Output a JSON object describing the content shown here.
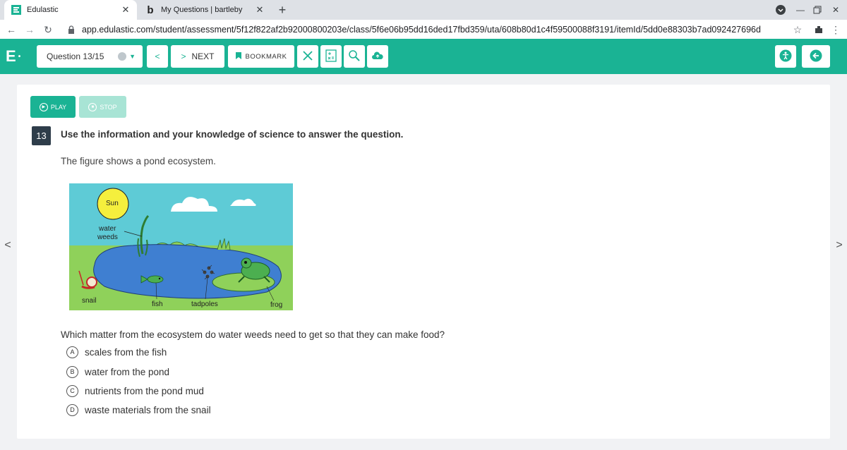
{
  "browser": {
    "tabs": [
      {
        "title": "Edulastic",
        "icon": "edulastic-favicon",
        "active": true
      },
      {
        "title": "My Questions | bartleby",
        "icon": "bartleby-favicon",
        "active": false
      }
    ],
    "url": "app.edulastic.com/student/assessment/5f12f822af2b92000800203e/class/5f6e06b95dd16ded17fbd359/uta/608b80d1c4f59500088f3191/itemId/5dd0e88303b7ad092427696d"
  },
  "header": {
    "logo": "E",
    "question_selector": "Question 13/15",
    "next_label": "NEXT",
    "bookmark_label": "BOOKMARK"
  },
  "audio": {
    "play_label": "PLAY",
    "stop_label": "STOP"
  },
  "question": {
    "number": "13",
    "stem": "Use the information and your knowledge of science to answer the question.",
    "figure_intro": "The figure shows a pond ecosystem.",
    "figure_labels": {
      "sun": "Sun",
      "water": "water",
      "weeds": "weeds",
      "snail": "snail",
      "fish": "fish",
      "tadpoles": "tadpoles",
      "frog": "frog"
    },
    "prompt": "Which matter from the ecosystem do water weeds need to get so that they can make food?",
    "choices": [
      {
        "letter": "A",
        "text": "scales from the fish"
      },
      {
        "letter": "B",
        "text": "water from the pond"
      },
      {
        "letter": "C",
        "text": "nutrients from the pond mud"
      },
      {
        "letter": "D",
        "text": "waste materials from the snail"
      }
    ]
  },
  "colors": {
    "brand": "#1ab394",
    "sky": "#5ecbd6",
    "grass": "#8fd15a",
    "pond": "#3f7fd1"
  }
}
